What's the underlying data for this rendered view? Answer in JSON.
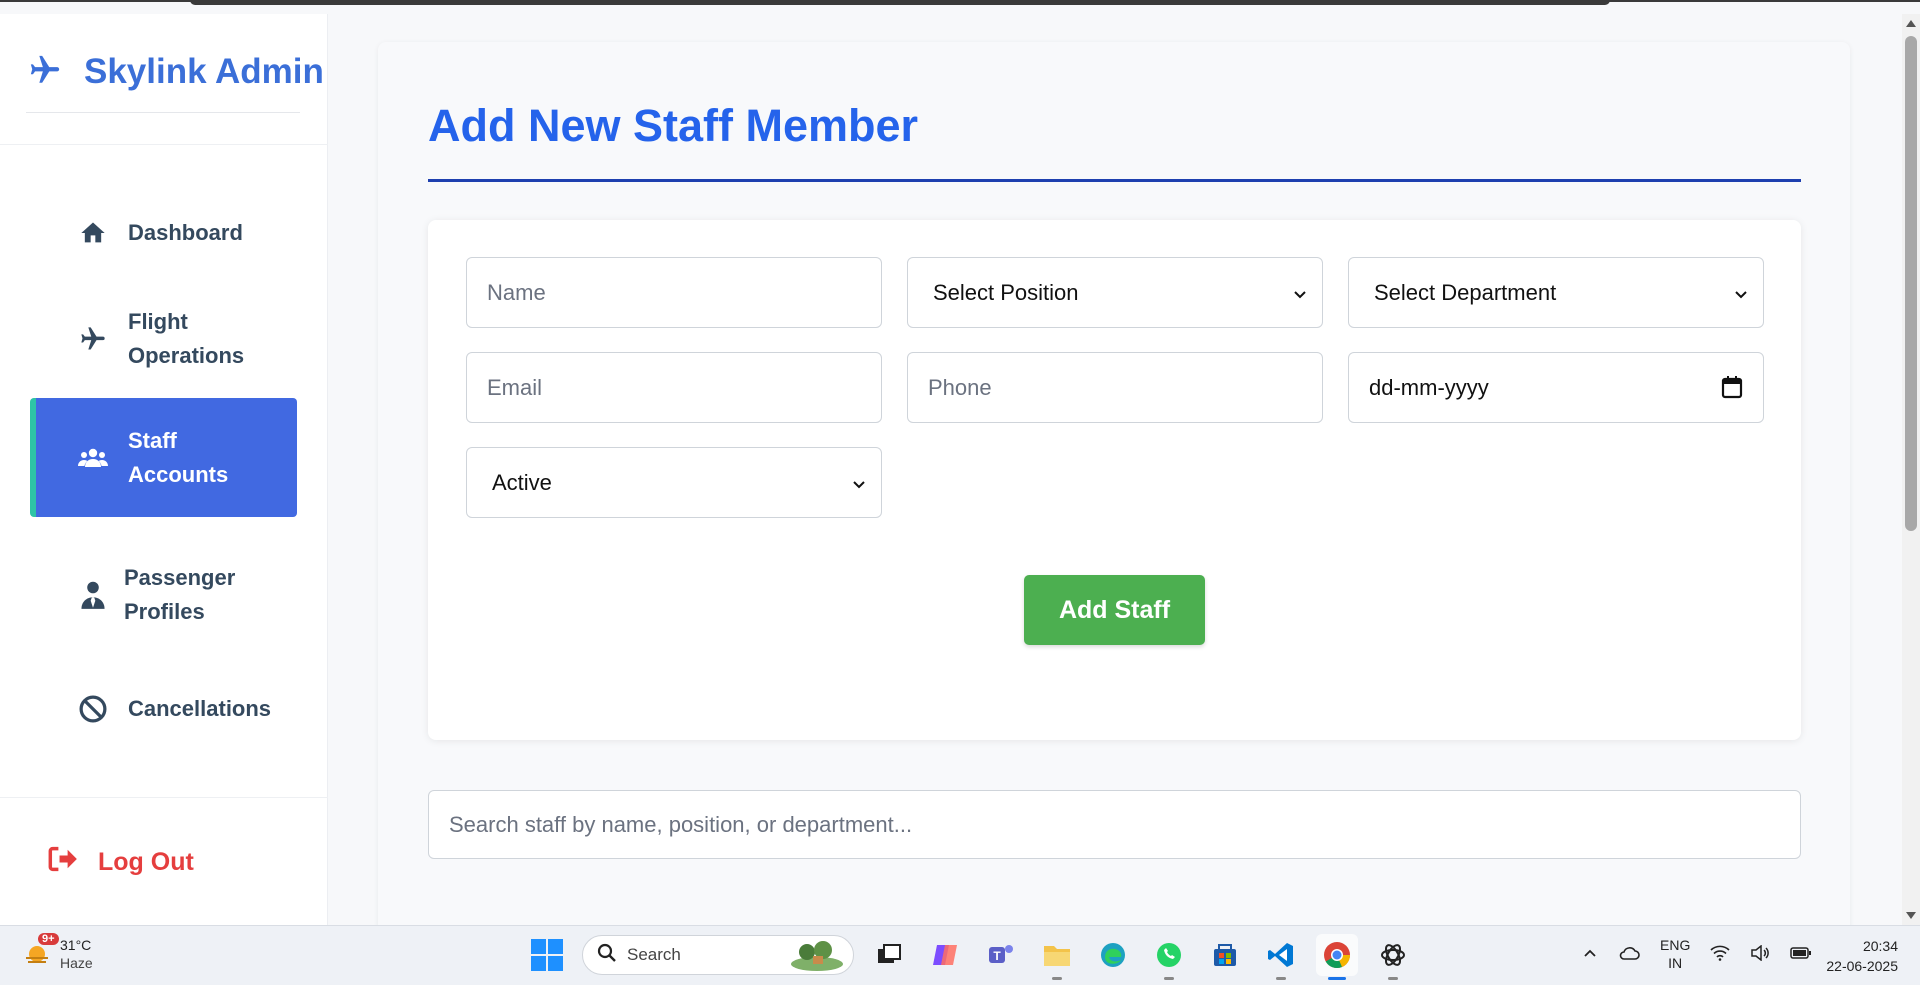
{
  "brand": {
    "title": "Skylink Admin"
  },
  "sidebar": {
    "items": [
      {
        "label": "Dashboard",
        "icon": "home-icon"
      },
      {
        "label": "Flight Operations",
        "icon": "plane-icon"
      },
      {
        "label": "Staff Accounts",
        "icon": "users-icon",
        "active": true
      },
      {
        "label": "Passenger Profiles",
        "icon": "user-tie-icon"
      },
      {
        "label": "Cancellations",
        "icon": "ban-icon"
      }
    ],
    "logout_label": "Log Out"
  },
  "main": {
    "title": "Add New Staff Member",
    "form": {
      "name_placeholder": "Name",
      "position_select": "Select Position",
      "department_select": "Select Department",
      "email_placeholder": "Email",
      "phone_placeholder": "Phone",
      "date_placeholder": "dd-mm-yyyy",
      "status_select": "Active",
      "submit_label": "Add Staff"
    },
    "search_placeholder": "Search staff by name, position, or department..."
  },
  "taskbar": {
    "weather": {
      "temp": "31°C",
      "condition": "Haze",
      "badge": "9+"
    },
    "search_label": "Search",
    "lang_top": "ENG",
    "lang_bottom": "IN",
    "time": "20:34",
    "date": "22-06-2025"
  },
  "colors": {
    "accent": "#2563eb",
    "sidebar_active": "#4169e1",
    "active_border": "#2ec4a6",
    "add_button": "#4caf50",
    "logout": "#e53e3e"
  }
}
